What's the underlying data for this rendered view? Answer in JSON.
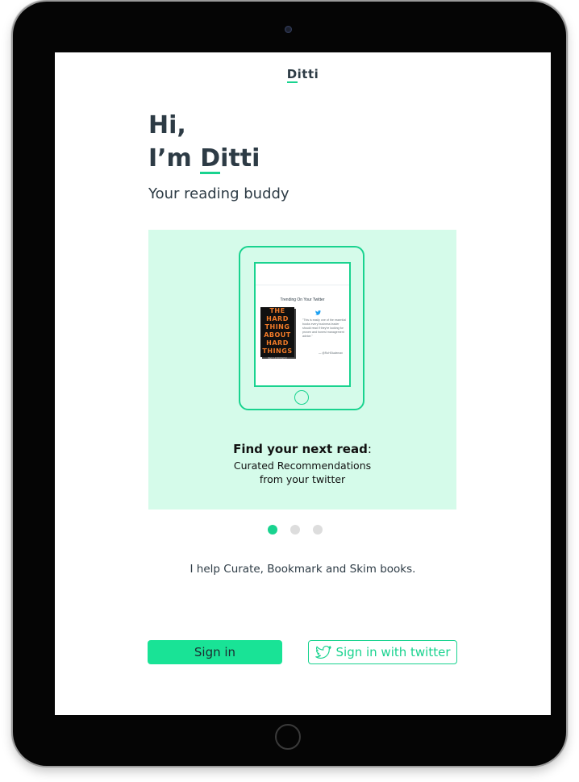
{
  "brand": {
    "logo_initial": "D",
    "logo_rest": "itti",
    "accent_color": "#19d38f",
    "button_color": "#19e396"
  },
  "hero": {
    "line1": "Hi,",
    "line2_prefix": "I’m ",
    "name_initial": "D",
    "name_rest": "itti",
    "tagline": "Your reading buddy"
  },
  "carousel": {
    "current_index": 0,
    "total": 3,
    "slide": {
      "mockup": {
        "section_title": "Trending On Your Twitter",
        "book_cover_lines": [
          "THE",
          "HARD",
          "THING",
          "ABOUT",
          "HARD",
          "THINGS"
        ],
        "book_author": "BEN HOROWITZ",
        "bird_icon": "twitter-bird-icon",
        "quote": "\"This is easily one of the essential books every business leader should read if they're looking for proven and honest management advice.\"",
        "quote_handle": "— @RoHStudeman"
      },
      "heading_bold": "Find your next read",
      "heading_colon": ":",
      "subline1": "Curated Recommendations",
      "subline2": "from your twitter"
    }
  },
  "help_text": "I help Curate, Bookmark and Skim books.",
  "actions": {
    "signin_label": "Sign in",
    "twitter_signin_label": "Sign in with twitter",
    "twitter_icon": "twitter-bird-icon"
  }
}
